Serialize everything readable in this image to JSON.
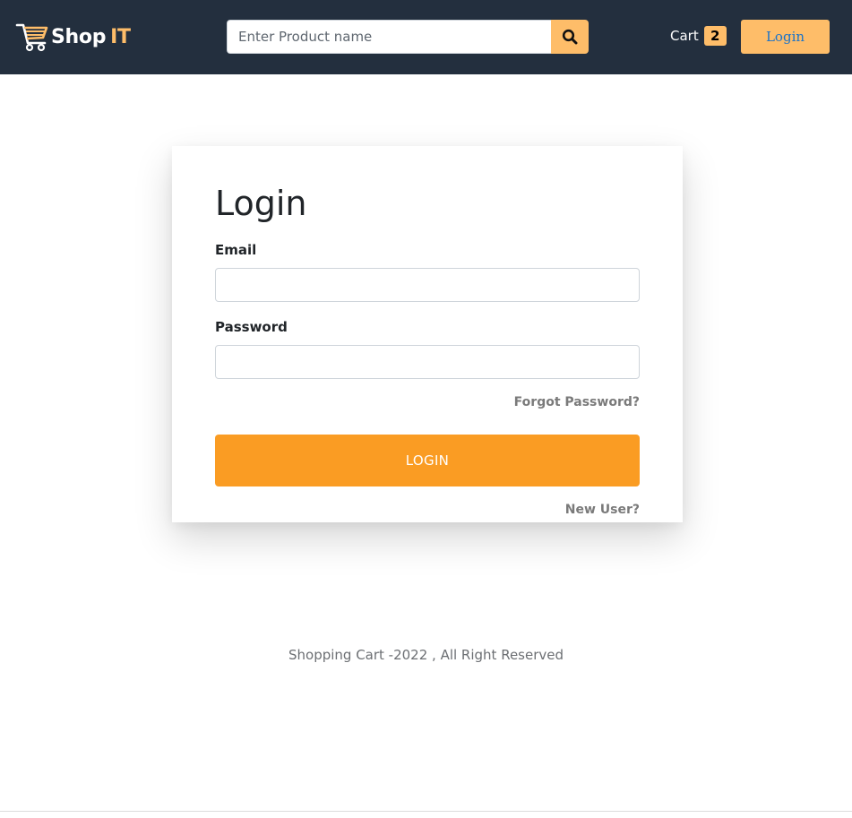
{
  "header": {
    "brand": {
      "name": "Shop",
      "accent": "IT",
      "icon": "shopping-cart-icon"
    },
    "search": {
      "placeholder": "Enter Product name",
      "value": "",
      "button_icon": "search-icon"
    },
    "cart": {
      "label": "Cart",
      "count": "2"
    },
    "login_label": "Login"
  },
  "login_form": {
    "title": "Login",
    "email_label": "Email",
    "email_value": "",
    "password_label": "Password",
    "password_value": "",
    "forgot_link": "Forgot Password?",
    "submit_label": "LOGIN",
    "new_user_link": "New User?"
  },
  "footer": {
    "text": "Shopping Cart -2022 , All Right Reserved"
  },
  "colors": {
    "navbar_bg": "#232f3e",
    "accent": "#febd69",
    "submit_button": "#fa9c23",
    "login_button_text": "#1a73c9"
  }
}
